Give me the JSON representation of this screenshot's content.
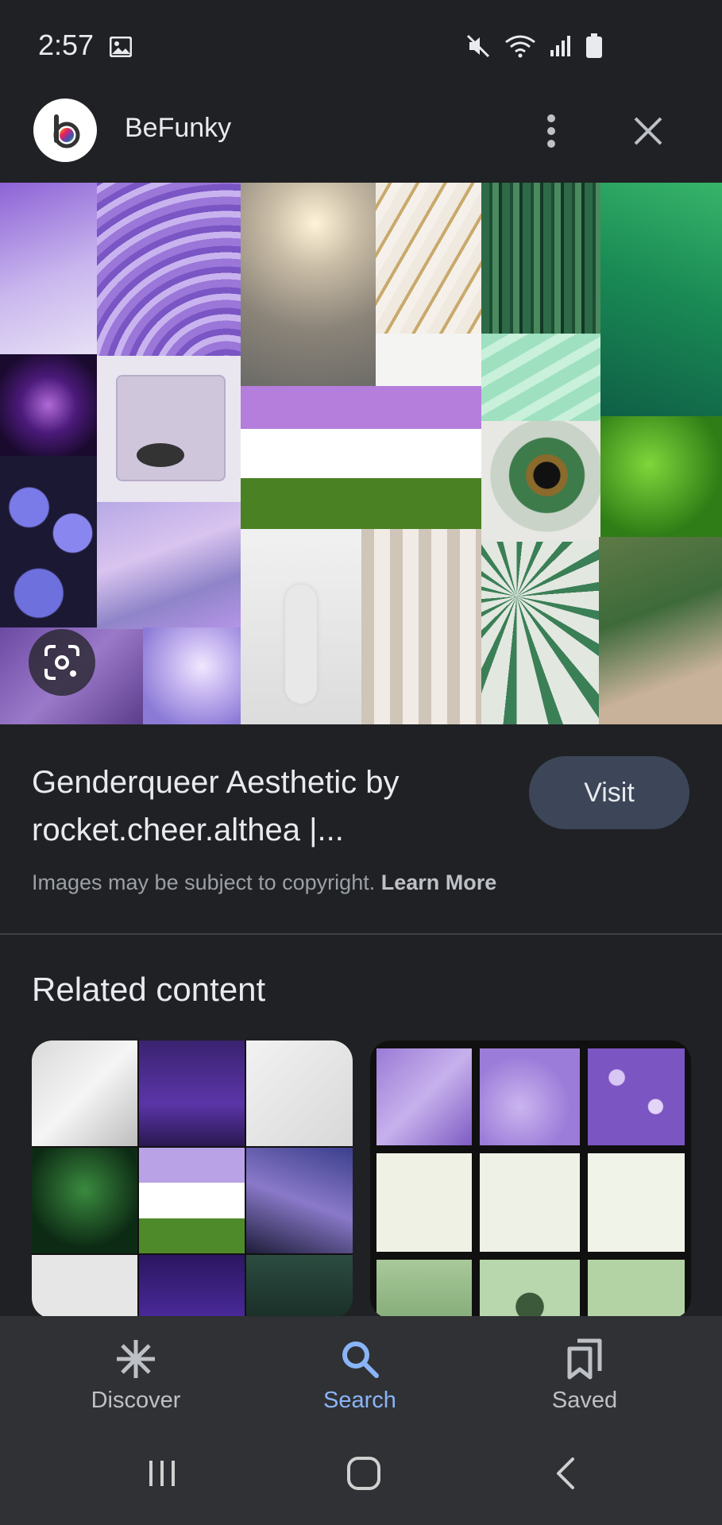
{
  "status_bar": {
    "time": "2:57"
  },
  "header": {
    "app_name": "BeFunky"
  },
  "result": {
    "title": "Genderqueer Aesthetic by rocket.cheer.althea |...",
    "visit_label": "Visit",
    "copyright_text": "Images may be subject to copyright.",
    "learn_more": "Learn More"
  },
  "related": {
    "heading": "Related content"
  },
  "bottom_nav": {
    "items": [
      {
        "label": "Discover",
        "icon": "asterisk-icon"
      },
      {
        "label": "Search",
        "icon": "search-icon"
      },
      {
        "label": "Saved",
        "icon": "bookmarks-icon"
      }
    ],
    "active": "Search"
  },
  "colors": {
    "background": "#202124",
    "accent": "#8ab4f8",
    "visit_button": "#3c4658",
    "flag_purple": "#b57edc",
    "flag_white": "#ffffff",
    "flag_green": "#4a8123"
  }
}
